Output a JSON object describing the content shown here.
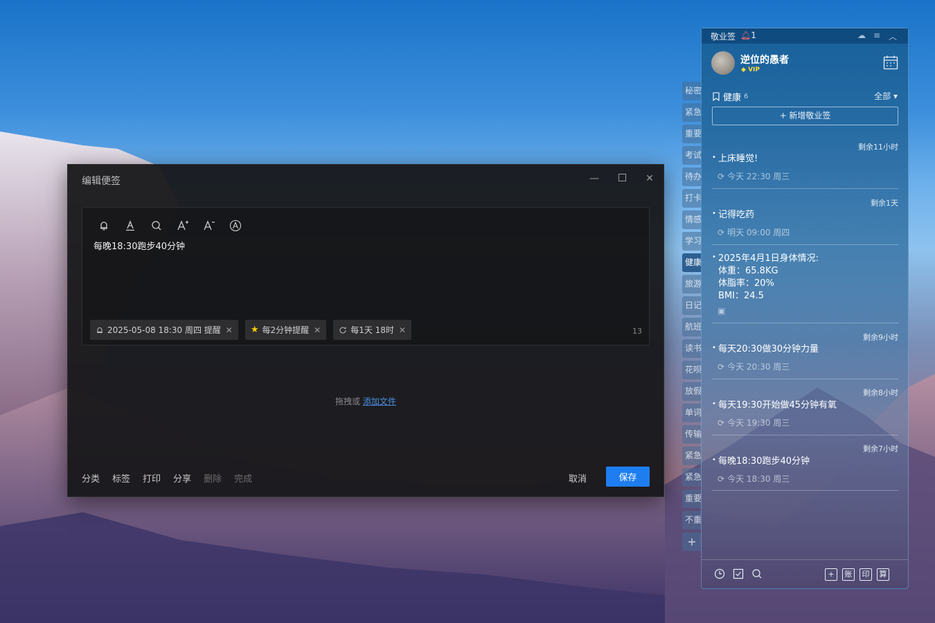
{
  "editor": {
    "title": "编辑便签",
    "content": "每晚18:30跑步40分钟",
    "chips": [
      {
        "icon": "bell-icon",
        "label": "2025-05-08 18:30 周四 提醒"
      },
      {
        "icon": "star-icon",
        "label": "每2分钟提醒"
      },
      {
        "icon": "repeat-icon",
        "label": "每1天 18时"
      }
    ],
    "char_count": "13",
    "drop_text": "拖拽或",
    "drop_link": "添加文件",
    "actions": [
      "分类",
      "标签",
      "打印",
      "分享",
      "删除",
      "完成"
    ],
    "cancel": "取消",
    "save": "保存"
  },
  "tabs": [
    "秘密",
    "紧急",
    "重要",
    "考试",
    "待办",
    "打卡",
    "情感",
    "学习",
    "健康",
    "旅游",
    "日记",
    "航班",
    "读书",
    "花呗",
    "放假",
    "单词",
    "传输",
    "紧急",
    "紧急",
    "重要",
    "不重"
  ],
  "tabs_active": "健康",
  "panel": {
    "app_name": "敬业签",
    "notif_count": "1",
    "username": "逆位的愚者",
    "vip": "VIP",
    "category": "健康",
    "category_count": "6",
    "filter": "全部",
    "new_button": "+ 新增敬业签",
    "items": [
      {
        "remain": "剩余11小时",
        "title": "上床睡觉!",
        "sub": "今天 22:30 周三"
      },
      {
        "remain": "剩余1天",
        "title": "记得吃药",
        "sub": "明天 09:00 周四"
      },
      {
        "remain": "",
        "title": "2025年4月1日身体情况:\n体重：65.8KG\n体脂率：20%\nBMI：24.5",
        "sub": ""
      },
      {
        "remain": "剩余9小时",
        "title": "每天20:30做30分钟力量",
        "sub": "今天 20:30 周三"
      },
      {
        "remain": "剩余8小时",
        "title": "每天19:30开始做45分钟有氧",
        "sub": "今天 19:30 周三"
      },
      {
        "remain": "剩余7小时",
        "title": "每晚18:30跑步40分钟",
        "sub": "今天 18:30 周三"
      }
    ],
    "footer_icons": [
      "clock-icon",
      "check-icon",
      "search-icon",
      "add-icon",
      "ledger-icon",
      "print-icon",
      "calc-icon"
    ],
    "footer_labels": [
      "+",
      "账",
      "印",
      "算"
    ]
  }
}
